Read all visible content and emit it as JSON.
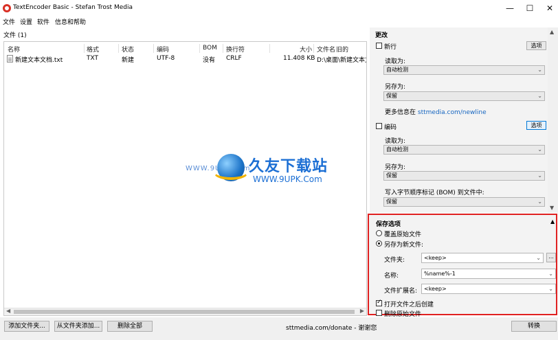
{
  "window": {
    "title": "TextEncoder Basic - Stefan Trost Media",
    "minimize_glyph": "—",
    "maximize_glyph": "☐",
    "close_glyph": "✕"
  },
  "menu": [
    "文件",
    "设置",
    "软件",
    "信息和帮助"
  ],
  "files": {
    "header": "文件 (1)",
    "columns": [
      "名称",
      "格式",
      "状态",
      "编码",
      "BOM",
      "换行符",
      "大小",
      "文件名",
      "旧的"
    ],
    "rows": [
      {
        "name": "新建文本文档.txt",
        "format": "TXT",
        "status": "新建",
        "encoding": "UTF-8",
        "bom": "没有",
        "linebreak": "CRLF",
        "size": "11.408 KB",
        "path": "D:\\桌面\\新建文本文档"
      }
    ]
  },
  "watermark": {
    "url_left": "WWW.9UPK.com",
    "brand": "久友下载站",
    "url": "WWW.9UPK.Com"
  },
  "changes": {
    "title": "更改",
    "newline": {
      "label": "新行",
      "checked": false,
      "option_button": "选项",
      "read_label": "读取为:",
      "read_value": "自动检测",
      "save_label": "另存为:",
      "save_value": "保留",
      "more_info_prefix": "更多信息在",
      "more_info_link": "sttmedia.com/newline"
    },
    "encoding": {
      "label": "编码",
      "checked": false,
      "option_button": "选项",
      "read_label": "读取为:",
      "read_value": "自动检测",
      "save_label": "另存为:",
      "save_value": "保留",
      "bom_label": "写入字节顺序标记 (BOM) 到文件中:",
      "bom_value": "保留"
    }
  },
  "save_options": {
    "title": "保存选项",
    "collapse_glyph": "▲",
    "overwrite_label": "覆盖原始文件",
    "save_as_new_label": "另存为新文件:",
    "selected": "save_as_new",
    "folder_label": "文件夹:",
    "folder_value": "<keep>",
    "browse_glyph": "...",
    "name_label": "名称:",
    "name_value": "%name%-1",
    "ext_label": "文件扩展名:",
    "ext_value": "<keep>",
    "create_after_open_label": "打开文件之后创建",
    "create_after_open_checked": true,
    "delete_original_label": "删除原始文件",
    "delete_original_checked": false
  },
  "bottom": {
    "add_files": "添加文件夹...",
    "add_from_folder": "从文件夹添加...",
    "remove_all": "删除全部",
    "donate_text": "sttmedia.com/donate - 谢谢您",
    "convert": "转换"
  },
  "colors": {
    "highlight_border": "#e02020",
    "link": "#1565c0",
    "panel_bg": "#f3f3f3"
  }
}
